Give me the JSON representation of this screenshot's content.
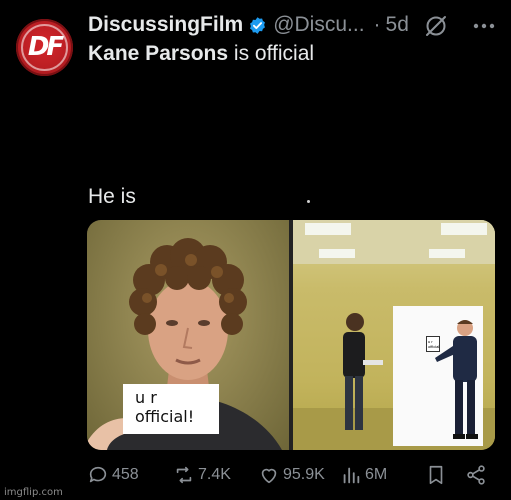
{
  "post": {
    "author_name": "DiscussingFilm",
    "handle": "@Discu...",
    "separator": "·",
    "time": "5d",
    "text_line1_name": "Kane Parsons",
    "text_line1_rest": " is official",
    "text_line2": "He is",
    "avatar_logo": "DF"
  },
  "media": {
    "left_note_line1": "u r",
    "left_note_line2": "official!",
    "right_card_line1": "u r",
    "right_card_line2": "official"
  },
  "actions": {
    "replies": "458",
    "reposts": "7.4K",
    "likes": "95.9K",
    "views": "6M"
  },
  "watermark": "imgflip.com",
  "colors": {
    "background": "#000000",
    "text": "#e7e9ea",
    "secondary_text": "#8b9096",
    "verified_badge": "#1d9bf0",
    "avatar_red": "#c8232a"
  }
}
